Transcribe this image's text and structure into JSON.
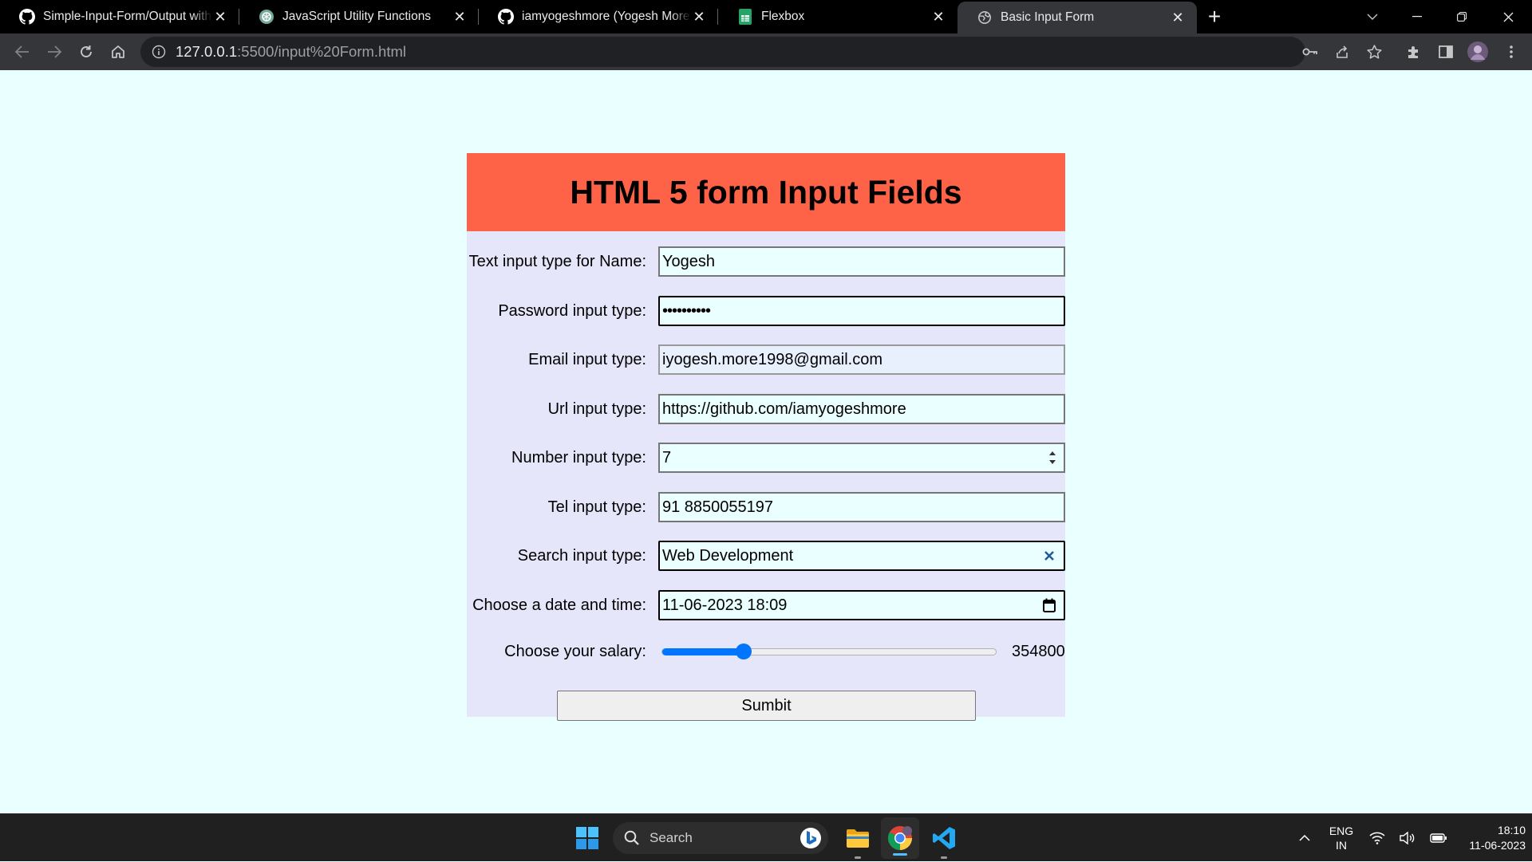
{
  "browser": {
    "tabs": [
      {
        "title": "Simple-Input-Form/Output with",
        "icon": "github-icon"
      },
      {
        "title": "JavaScript Utility Functions",
        "icon": "chatgpt-icon"
      },
      {
        "title": "iamyogeshmore (Yogesh More)",
        "icon": "github-icon"
      },
      {
        "title": "Flexbox",
        "icon": "sheets-icon"
      },
      {
        "title": "Basic Input Form",
        "icon": "globe-icon"
      }
    ],
    "close_glyph": "✕",
    "new_tab_glyph": "+",
    "url_host": "127.0.0.1",
    "url_rest": ":5500/input%20Form.html"
  },
  "form": {
    "title": "HTML 5 form Input Fields",
    "fields": {
      "name": {
        "label": "Text input type for Name:",
        "value": "Yogesh"
      },
      "password": {
        "label": "Password input type:",
        "value": "••••••••••"
      },
      "email": {
        "label": "Email input type:",
        "value": "iyogesh.more1998@gmail.com"
      },
      "url": {
        "label": "Url input type:",
        "value": "https://github.com/iamyogeshmore"
      },
      "number": {
        "label": "Number input type:",
        "value": "7"
      },
      "tel": {
        "label": "Tel input type:",
        "value": "91 8850055197"
      },
      "search": {
        "label": "Search input type:",
        "value": "Web Development"
      },
      "datetime": {
        "label": "Choose a date and time:",
        "value": "11-06-2023 18:09"
      },
      "salary": {
        "label": "Choose your salary:",
        "value_text": "354800",
        "fraction": 0.245
      }
    },
    "submit_label": "Sumbit"
  },
  "taskbar": {
    "search_label": "Search",
    "lang_top": "ENG",
    "lang_bottom": "IN",
    "time": "18:10",
    "date": "11-06-2023"
  },
  "colors": {
    "header_bg": "#ff6347",
    "form_bg": "#e6e6fa",
    "page_bg": "#eaffff",
    "accent": "#0075ff"
  }
}
